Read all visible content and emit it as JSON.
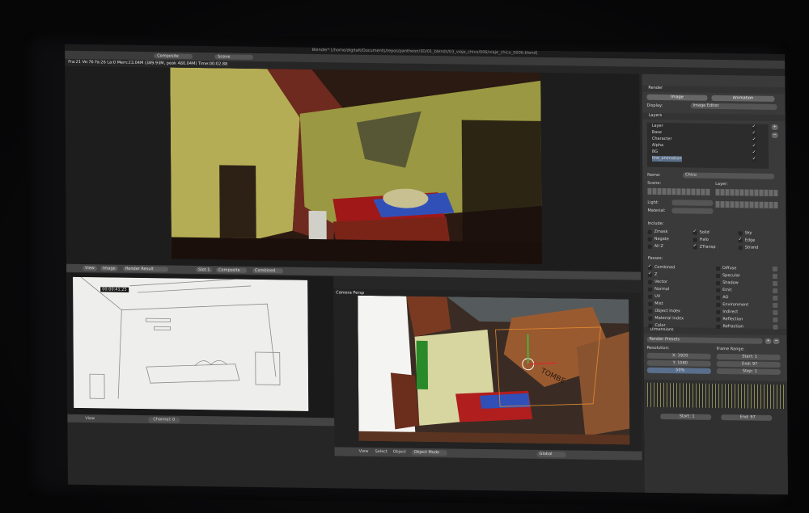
{
  "window": {
    "title": "Blender* [/home/digitalt/Documents/repos/pantheon/3D/01_blends/03_viaje_chico/006/viaje_chico_0006.blend]"
  },
  "topbar": {
    "layout": "Composite",
    "scene": "Scene"
  },
  "status": {
    "line": "Fra:21  Ve:76 Fa:26 La:0 Mem:23.04M (389.93M, peak 480.04M) Time:00:02.88"
  },
  "render_header": {
    "view": "View",
    "image": "Image",
    "image_name": "Render Result",
    "slot": "Slot 1",
    "layer": "Composite",
    "pass": "Combined"
  },
  "sketch": {
    "timecode": "00:00:41:25",
    "header_view": "View",
    "channel": "Channel: 0"
  },
  "camera": {
    "label": "Camera Persp",
    "box_text": "TOMBE",
    "header": {
      "view": "View",
      "select": "Select",
      "object": "Object",
      "mode": "Object Mode",
      "orientation": "Global"
    }
  },
  "props": {
    "render_section": "Render",
    "image_btn": "Image",
    "animation_btn": "Animation",
    "display_label": "Display:",
    "display_value": "Image Editor",
    "layers_section": "Layers",
    "layers": [
      {
        "name": "Layer",
        "on": true
      },
      {
        "name": "Base",
        "on": true
      },
      {
        "name": "Character",
        "on": true
      },
      {
        "name": "Alpha",
        "on": true
      },
      {
        "name": "BG",
        "on": true
      },
      {
        "name": "line_animation",
        "on": true
      }
    ],
    "name_label": "Name:",
    "name_value": "Chico",
    "scene_label": "Scene:",
    "layer_label": "Layer:",
    "light_label": "Light:",
    "material_label": "Material:",
    "include_label": "Include:",
    "include_col1": [
      {
        "name": "Zmask",
        "on": false
      },
      {
        "name": "Negate",
        "on": false
      },
      {
        "name": "All Z",
        "on": false
      }
    ],
    "include_col2": [
      {
        "name": "Solid",
        "on": true
      },
      {
        "name": "Halo",
        "on": false
      },
      {
        "name": "ZTransp",
        "on": true
      }
    ],
    "include_col3": [
      {
        "name": "Sky",
        "on": false
      },
      {
        "name": "Edge",
        "on": true
      },
      {
        "name": "Strand",
        "on": false
      }
    ],
    "passes_label": "Passes:",
    "passes_col1": [
      {
        "name": "Combined",
        "on": true
      },
      {
        "name": "Z",
        "on": true
      },
      {
        "name": "Vector",
        "on": false
      },
      {
        "name": "Normal",
        "on": false
      },
      {
        "name": "UV",
        "on": false
      },
      {
        "name": "Mist",
        "on": false
      },
      {
        "name": "Object Index",
        "on": false
      },
      {
        "name": "Material Index",
        "on": false
      },
      {
        "name": "Color",
        "on": false
      }
    ],
    "passes_col2": [
      {
        "name": "Diffuse",
        "on": false
      },
      {
        "name": "Specular",
        "on": false
      },
      {
        "name": "Shadow",
        "on": false
      },
      {
        "name": "Emit",
        "on": false
      },
      {
        "name": "AO",
        "on": false
      },
      {
        "name": "Environment",
        "on": false
      },
      {
        "name": "Indirect",
        "on": false
      },
      {
        "name": "Reflection",
        "on": false
      },
      {
        "name": "Refraction",
        "on": false
      }
    ],
    "dimensions_section": "Dimensions",
    "render_presets": "Render Presets",
    "resolution_label": "Resolution:",
    "res_x": "X: 1920",
    "res_y": "Y: 1080",
    "res_pct": "50%",
    "frame_range_label": "Frame Range:",
    "start": "Start: 1",
    "end": "End: 97",
    "step": "Step: 1",
    "bottom_start": "Start: 1",
    "bottom_end": "End: 97"
  }
}
